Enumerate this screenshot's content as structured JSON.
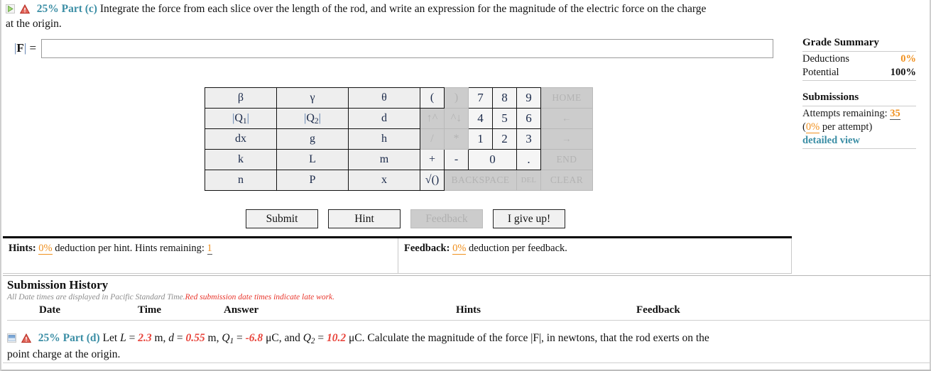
{
  "part_c": {
    "toggle_icon": "play-triangle-icon",
    "warning_icon": "warning-triangle-icon",
    "label": "25% Part (c)",
    "text_line1": "Integrate the force from each slice over the length of the rod, and write an expression for the magnitude of the electric force on the charge",
    "text_line2": "at the origin."
  },
  "answer": {
    "label_bar_open": "|",
    "label_symbol": "F",
    "label_bar_close": "|",
    "label_equals": "=",
    "value": "",
    "placeholder": ""
  },
  "grade_summary": {
    "title": "Grade Summary",
    "deductions_label": "Deductions",
    "deductions_value": "0%",
    "potential_label": "Potential",
    "potential_value": "100%",
    "submissions_title": "Submissions",
    "attempts_label": "Attempts remaining:",
    "attempts_value": "35",
    "per_attempt_open": "(",
    "per_attempt_value": "0%",
    "per_attempt_text": " per attempt)",
    "detailed_view": "detailed view"
  },
  "keypad": {
    "rows": [
      {
        "sym": [
          "β",
          "γ",
          "θ"
        ],
        "ops": [
          {
            "label": "(",
            "disabled": false
          },
          {
            "label": ")",
            "disabled": true
          }
        ],
        "nums": [
          "7",
          "8",
          "9"
        ],
        "nav": {
          "label": "HOME",
          "disabled": true
        }
      },
      {
        "sym": [
          "|Q1|",
          "|Q2|",
          "d"
        ],
        "ops": [
          {
            "label": "↑^",
            "disabled": true
          },
          {
            "label": "^↓",
            "disabled": true
          }
        ],
        "nums": [
          "4",
          "5",
          "6"
        ],
        "nav": {
          "label": "←",
          "disabled": true
        }
      },
      {
        "sym": [
          "dx",
          "g",
          "h"
        ],
        "ops": [
          {
            "label": "/",
            "disabled": true
          },
          {
            "label": "*",
            "disabled": true
          }
        ],
        "nums": [
          "1",
          "2",
          "3"
        ],
        "nav": {
          "label": "→",
          "disabled": true
        }
      },
      {
        "sym": [
          "k",
          "L",
          "m"
        ],
        "ops": [
          {
            "label": "+",
            "disabled": false
          },
          {
            "label": "-",
            "disabled": false
          }
        ],
        "nums": [
          "0",
          "."
        ],
        "nav": {
          "label": "END",
          "disabled": true
        }
      },
      {
        "sym": [
          "n",
          "P",
          "x"
        ],
        "ops": [
          {
            "label": "√()",
            "disabled": false
          }
        ],
        "backspace": "BACKSPACE",
        "del": "DEL",
        "nav": {
          "label": "CLEAR",
          "disabled": true
        }
      }
    ],
    "sqrt_label": "√()",
    "backspace_label": "BACKSPACE",
    "del_label": "DEL",
    "clear_label": "CLEAR"
  },
  "actions": {
    "submit": "Submit",
    "hint": "Hint",
    "feedback": "Feedback",
    "give_up": "I give up!"
  },
  "hints_bar": {
    "hints_label": "Hints:",
    "hints_pct": "0%",
    "hints_text": "deduction per hint. Hints remaining:",
    "hints_remaining": "1",
    "feedback_label": "Feedback:",
    "feedback_pct": "0%",
    "feedback_text": "deduction per feedback."
  },
  "submission_history": {
    "title": "Submission History",
    "note_gray": "All Date times are displayed in Pacific Standard Time.",
    "note_red": "Red submission date times indicate late work.",
    "columns": [
      "Date",
      "Time",
      "Answer",
      "Hints",
      "Feedback"
    ],
    "rows": []
  },
  "part_d": {
    "toggle_icon": "collapsed-box-icon",
    "warning_icon": "warning-triangle-icon",
    "label": "25% Part (d)",
    "t1": "Let ",
    "var_L": "L",
    "eq1": " = ",
    "val_L": "2.3",
    "unit_L": " m, ",
    "var_d": "d",
    "eq2": " = ",
    "val_d": "0.55",
    "unit_d": " m, ",
    "var_Q1": "Q",
    "var_Q1_sub": "1",
    "eq3": " = ",
    "val_Q1": "-6.8",
    "unit_Q1": " μC, and ",
    "var_Q2": "Q",
    "var_Q2_sub": "2",
    "eq4": " = ",
    "val_Q2": "10.2",
    "unit_Q2": " μC. ",
    "tail": "Calculate the magnitude of the force |F|, in newtons, that the rod exerts on the",
    "line2": "point charge at the origin."
  },
  "colors": {
    "accent_teal": "#3b8ea5",
    "orange": "#f0901e",
    "red": "#e8453c",
    "warning_red": "#d9342b",
    "play_green": "#8fcf5f"
  }
}
